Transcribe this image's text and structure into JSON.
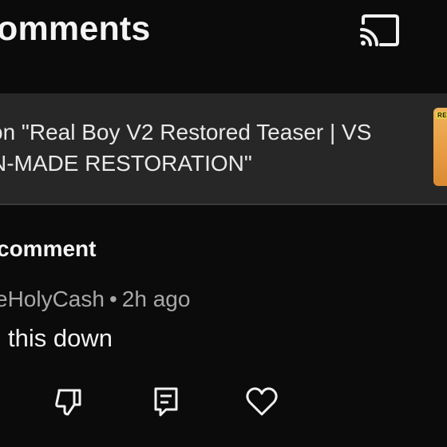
{
  "header": {
    "title": "omments",
    "cast_icon": "cast-icon"
  },
  "video_card": {
    "line1": "on \"Real Boy V2 Restored Teaser | VS",
    "line2": "N-MADE RESTORATION\"",
    "thumbnail_label": "RE"
  },
  "section": {
    "label": "comment"
  },
  "comment": {
    "author": "eHolyCash",
    "separator": "•",
    "time": "2h ago",
    "text": "this down"
  },
  "actions": {
    "dislike_icon": "thumbs-down-icon",
    "reply_icon": "reply-icon",
    "heart_icon": "heart-icon"
  },
  "colors": {
    "background": "#0b0b0b",
    "card": "#272727",
    "text": "#f1f1f1",
    "meta": "#a8a8a8"
  }
}
